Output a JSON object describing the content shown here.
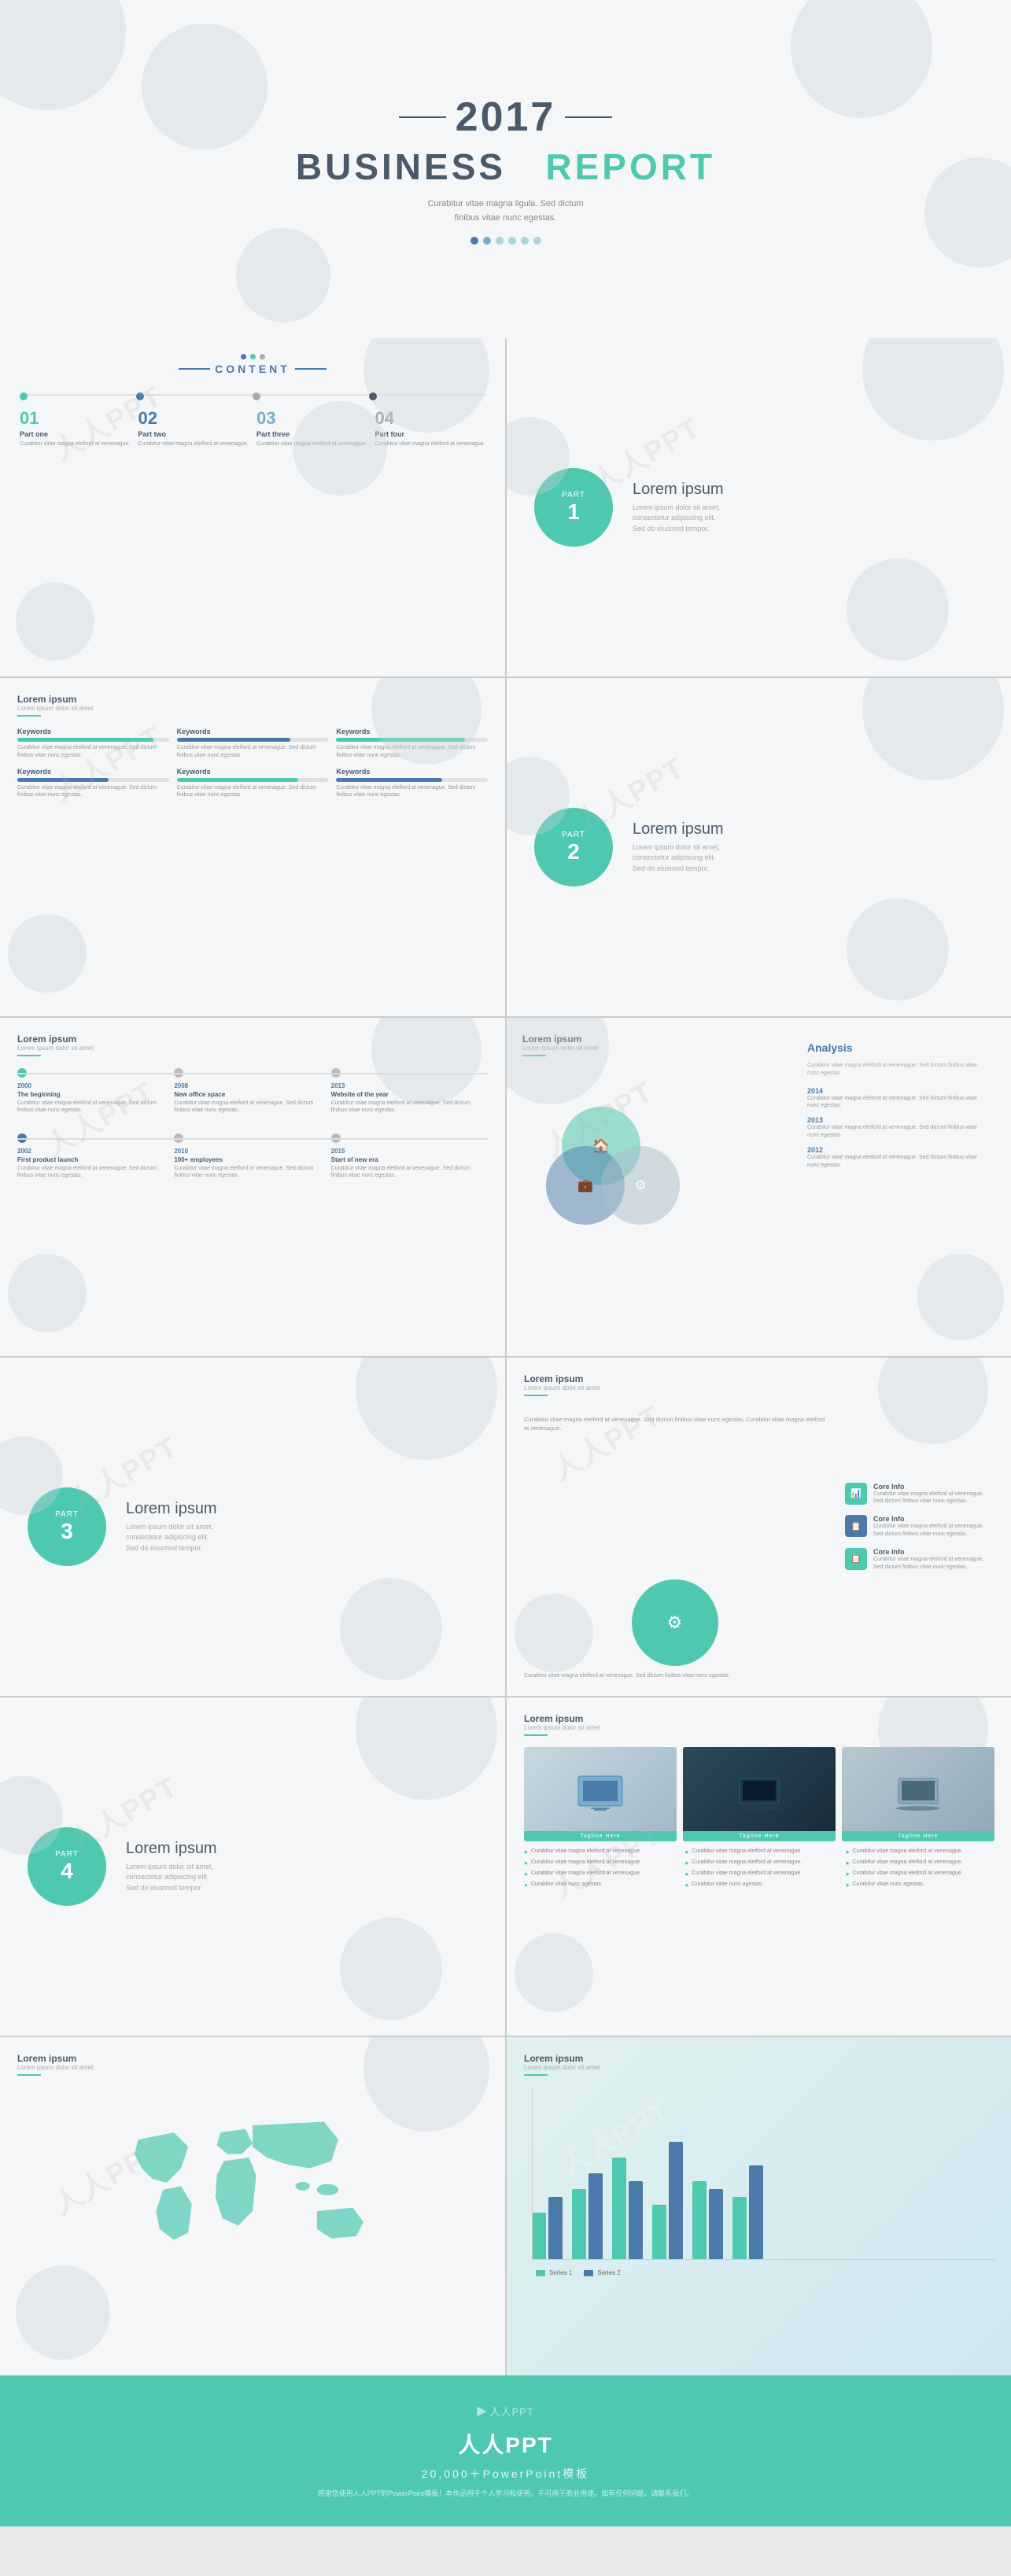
{
  "slide1": {
    "year": "2017",
    "title_part1": "BUSINESS",
    "title_part2": "REPORT",
    "subtitle": "Curabitur vitae magna ligula. Sed dictum\nfinibus vitae nunc egestas.",
    "dots": [
      "dot1",
      "dot2",
      "dot3",
      "dot4",
      "dot5",
      "dot6"
    ]
  },
  "slide2": {
    "section_label": "CONTENT",
    "items": [
      {
        "num": "01",
        "title": "Part one",
        "desc": "Curabitur vitae magna eleiford at venenague."
      },
      {
        "num": "02",
        "title": "Part two",
        "desc": "Curabitur vitae magna eleiford at venenague."
      },
      {
        "num": "03",
        "title": "Part three",
        "desc": "Curabitur vitae magna eleiford at venenague."
      },
      {
        "num": "04",
        "title": "Part four",
        "desc": "Curabitur vitae magna eleiford at venenague."
      }
    ]
  },
  "slide3": {
    "part_label": "PART",
    "part_num": "1",
    "title": "Lorem ipsum",
    "desc_lines": [
      "Lorem ipsum dolor sit amet,",
      "consectetur adipiscing elit."
    ]
  },
  "slide4": {
    "header_title": "Lorem ipsum",
    "header_sub": "Lorem ipsum dolor sit amet",
    "keywords": [
      {
        "label": "Keywords",
        "pct": 90,
        "desc": "Curabitur vitae magna eleiford at venenague. Sed dictum finibus vitae nunc egestas."
      },
      {
        "label": "Keywords",
        "pct": 75,
        "desc": "Curabitur vitae magna eleiford at venenague. Sed dictum finibus vitae nunc egestas."
      },
      {
        "label": "Keywords",
        "pct": 85,
        "desc": "Curabitur vitae magna eleiford at venenague. Sed dictum finibus vitae nunc egestas."
      },
      {
        "label": "Keywords",
        "pct": 60,
        "desc": "Curabitur vitae magna eleiford at venenague. Sed dictum finibus vitae nunc egestas."
      },
      {
        "label": "Keywords",
        "pct": 80,
        "desc": "Curabitur vitae magna eleiford at venenague. Sed dictum finibus vitae nunc egestas."
      },
      {
        "label": "Keywords",
        "pct": 70,
        "desc": "Curabitur vitae magna eleiford at venenague. Sed dictum finibus vitae nunc egestas."
      }
    ]
  },
  "slide5": {
    "part_label": "PART",
    "part_num": "2",
    "title": "Lorem ipsum",
    "desc_lines": [
      "Lorem ipsum dolor sit amet,",
      "consectetur adipiscing elit."
    ]
  },
  "slide6": {
    "header_title": "Lorem ipsum",
    "header_sub": "Lorem ipsum dolor sit amet",
    "timeline": [
      {
        "year": "2000",
        "event": "The beginning",
        "desc": "Curabitur vitae magna eleiford at venenague. Sed dictum finibus vitae nunc egestas."
      },
      {
        "year": "2008",
        "event": "New office space",
        "desc": "Curabitur vitae magna eleiford at venenague. Sed dictum finibus vitae nunc egestas."
      },
      {
        "year": "2013",
        "event": "Website of the year",
        "desc": "Curabitur vitae magna eleiford at venenague. Sed dictum finibus vitae nunc egestas."
      }
    ],
    "timeline2": [
      {
        "year": "2002",
        "event": "First product launch",
        "desc": "Curabitur vitae magna eleiford at venenague. Sed dictum finibus vitae nunc egestas."
      },
      {
        "year": "2010",
        "event": "100+ employees",
        "desc": "Curabitur vitae magna eleiford at venenague. Sed dictum finibus vitae nunc egestas."
      },
      {
        "year": "2015",
        "event": "Start of new era",
        "desc": "Curabitur vitae magna eleiford at venenague. Sed dictum finibus vitae nunc egestas."
      }
    ]
  },
  "slide7": {
    "header_title": "Lorem ipsum",
    "header_sub": "Lorem ipsum dolor sit amet",
    "analysis_title": "Analysis",
    "analysis_desc": "Curabitur vitae magna eleiford at venenague. Sed dictum finibus vitae nunc egestas.",
    "years": [
      {
        "year": "2014",
        "desc": "Curabitur vitae magna eleiford at venenague. Sed dictum finibus vitae nunc egestas."
      },
      {
        "year": "2013",
        "desc": "Curabitur vitae magna eleiford at venenague. Sed dictum finibus vitae nunc egestas."
      },
      {
        "year": "2012",
        "desc": "Curabitur vitae magna eleiford at venenague. Sed dictum finibus vitae nunc egestas."
      }
    ],
    "venn_icons": [
      "🏠",
      "💼",
      "⚙"
    ]
  },
  "slide8": {
    "part_label": "PART",
    "part_num": "3",
    "title": "Lorem ipsum",
    "desc_lines": [
      "Lorem ipsum dolor sit amet,",
      "consectetur adipiscing elit."
    ]
  },
  "slide9": {
    "header_title": "Lorem ipsum",
    "header_sub": "Lorem ipsum dolor sit amet",
    "core_icon": "⚙",
    "core_items": [
      {
        "label": "Core Info",
        "desc": "Curabitur vitae magna eleiford at venenague. Sed dictum finibus vitae nunc egestas.",
        "icon": "📊"
      },
      {
        "label": "Core Info",
        "desc": "Curabitur vitae magna eleiford at venenague. Sed dictum finibus vitae nunc egestas.",
        "icon": "📋"
      },
      {
        "label": "Core Info",
        "desc": "Curabitur vitae magna eleiford at venenague. Sed dictum finibus vitae nunc egestas.",
        "icon": "📋"
      }
    ]
  },
  "slide10": {
    "part_label": "PART",
    "part_num": "4",
    "title": "Lorem ipsum",
    "desc_lines": [
      "Lorem ipsum dolor sit amet,",
      "consectetur adipiscing elit."
    ]
  },
  "slide11": {
    "header_title": "Lorem ipsum",
    "header_sub": "Lorem ipsum dolor sit amet",
    "images": [
      {
        "label": "Tagline Here"
      },
      {
        "label": "Tagline Here"
      },
      {
        "label": "Tagline Here"
      }
    ],
    "bullets": [
      [
        "Curabitur vitae magna eleiford at venenague.",
        "Curabitur vitae magna eleiford at venenague.",
        "Curabitur vitae magna eleiford at venenague.",
        "Curabitur vitae nunc agestas."
      ],
      [
        "Curabitur vitae magna eleiford at venenague.",
        "Curabitur vitae magna eleiford at venenague.",
        "Curabitur vitae magna eleiford at venenague.",
        "Curabitur vitae nunc agestas."
      ],
      [
        "Curabitur vitae magna eleiford at venenague.",
        "Curabitur vitae magna eleiford at venenague.",
        "Curabitur vitae magna eleiford at venenague.",
        "Curabitur vitae nunc agestas."
      ]
    ]
  },
  "slide12": {
    "header_title": "Lorem ipsum",
    "header_sub": "Lorem ipsum dolor sit amet"
  },
  "slide13": {
    "header_title": "Lorem ipsum",
    "header_sub": "Lorem ipsum dolor sit amet",
    "bars": [
      {
        "teal": 60,
        "blue": 80
      },
      {
        "teal": 90,
        "blue": 110
      },
      {
        "teal": 130,
        "blue": 100
      },
      {
        "teal": 70,
        "blue": 150
      },
      {
        "teal": 100,
        "blue": 90
      },
      {
        "teal": 80,
        "blue": 120
      }
    ]
  },
  "footer": {
    "logo": "人人PPT",
    "title": "人人PPT",
    "subtitle": "20,000＋PowerPoint模板",
    "desc": "感谢您使用人人PPT的PowerPoint模板！本作品用于个人学习和使用，不可用于商业用途。如有任何问题，请联系我们。"
  }
}
